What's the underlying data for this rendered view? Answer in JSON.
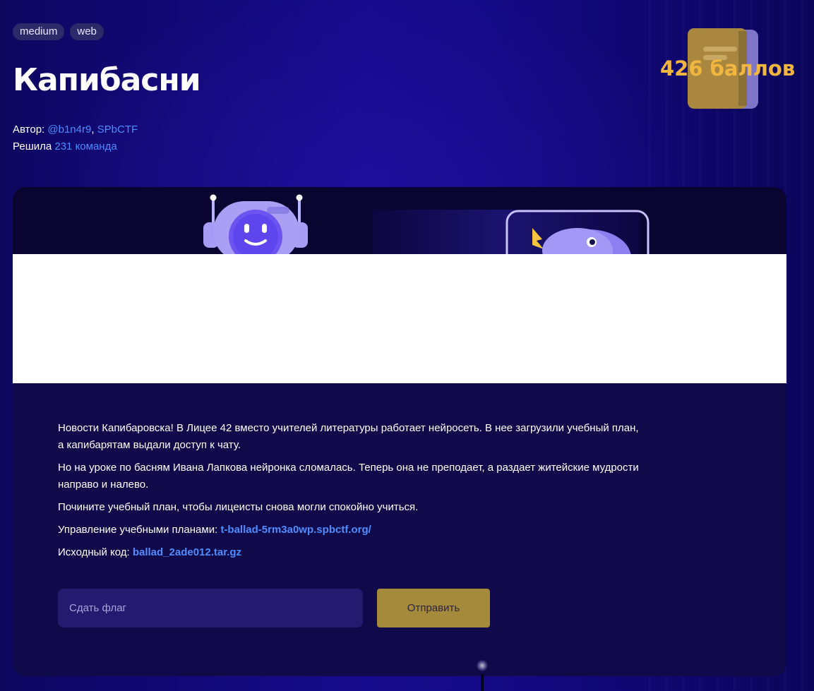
{
  "tags": [
    "medium",
    "web"
  ],
  "title": "Капибасни",
  "points": "426 баллов",
  "author": {
    "label": "Автор:",
    "handle": "@b1n4r9",
    "separator": ",",
    "team": "SPbCTF"
  },
  "solved": {
    "label": "Решила",
    "count_text": "231 команда"
  },
  "description": {
    "paragraphs": [
      "Новости Капибаровска! В Лицее 42 вместо учителей литературы работает нейросеть. В нее загрузили учебный план, а капибарятам выдали доступ к чату.",
      "Но на уроке по басням Ивана Лапкова нейронка сломалась. Теперь она не преподает, а раздает житейские мудрости направо и налево.",
      "Почините учебный план, чтобы лицеисты снова могли спокойно учиться."
    ],
    "control_label": "Управление учебными планами:",
    "control_link": "t-ballad-5rm3a0wp.spbctf.org/",
    "source_label": "Исходный код:",
    "source_link": "ballad_2ade012.tar.gz"
  },
  "flag_form": {
    "placeholder": "Сдать флаг",
    "value": "",
    "submit_label": "Отправить"
  },
  "icons": {
    "book": "book-icon",
    "robot": "robot-illustration",
    "bird": "bird-illustration"
  },
  "colors": {
    "accent_link": "#4f8cff",
    "points": "#f1b640",
    "submit_bg": "#a58a3c",
    "input_bg": "#241b70",
    "card_bg": "#100a4a",
    "tag_bg": "#2d2a6a"
  }
}
